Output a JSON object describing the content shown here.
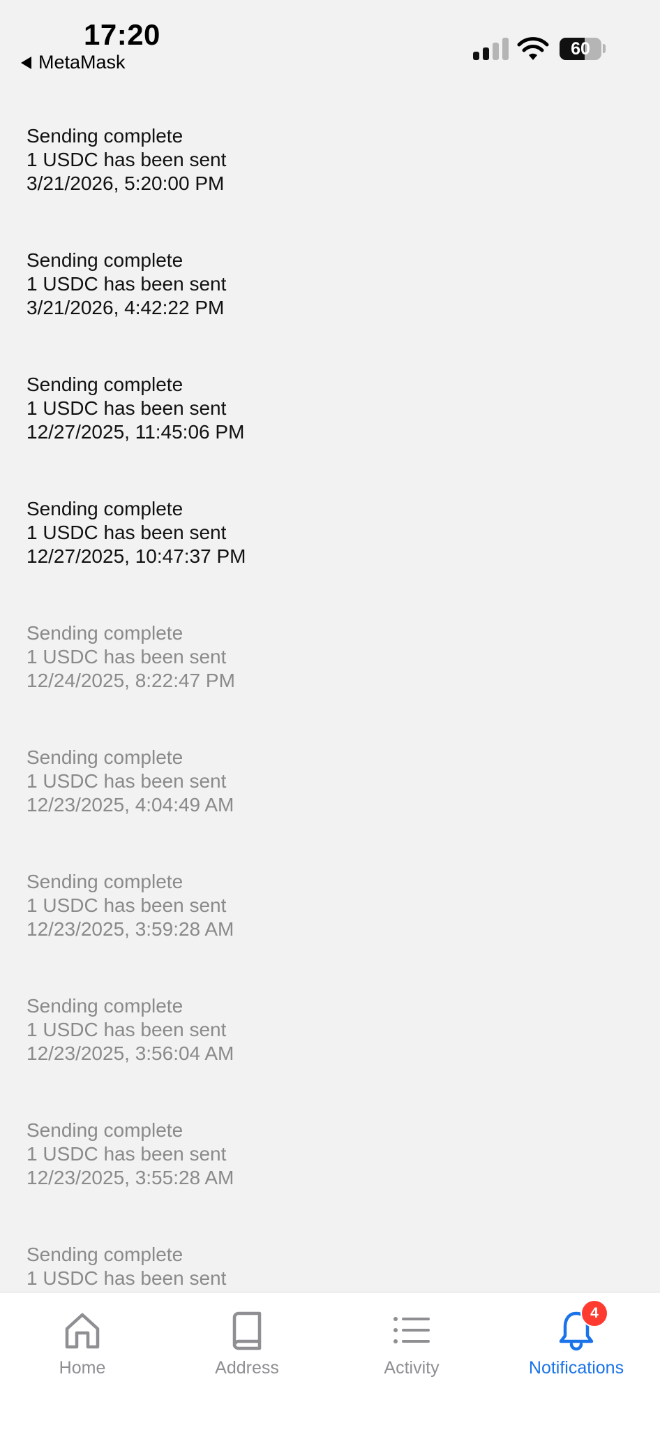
{
  "status_bar": {
    "time": "17:20",
    "back_app": "MetaMask",
    "battery_level": "60",
    "battery_fraction": 0.6,
    "signal_bars_filled": 2,
    "signal_bars_total": 4
  },
  "notifications": [
    {
      "title": "Sending complete",
      "message": "1 USDC has been sent",
      "timestamp": "3/21/2026, 5:20:00 PM",
      "read": false
    },
    {
      "title": "Sending complete",
      "message": "1 USDC has been sent",
      "timestamp": "3/21/2026, 4:42:22 PM",
      "read": false
    },
    {
      "title": "Sending complete",
      "message": "1 USDC has been sent",
      "timestamp": "12/27/2025, 11:45:06 PM",
      "read": false
    },
    {
      "title": "Sending complete",
      "message": "1 USDC has been sent",
      "timestamp": "12/27/2025, 10:47:37 PM",
      "read": false
    },
    {
      "title": "Sending complete",
      "message": "1 USDC has been sent",
      "timestamp": "12/24/2025, 8:22:47 PM",
      "read": true
    },
    {
      "title": "Sending complete",
      "message": "1 USDC has been sent",
      "timestamp": "12/23/2025, 4:04:49 AM",
      "read": true
    },
    {
      "title": "Sending complete",
      "message": "1 USDC has been sent",
      "timestamp": "12/23/2025, 3:59:28 AM",
      "read": true
    },
    {
      "title": "Sending complete",
      "message": "1 USDC has been sent",
      "timestamp": "12/23/2025, 3:56:04 AM",
      "read": true
    },
    {
      "title": "Sending complete",
      "message": "1 USDC has been sent",
      "timestamp": "12/23/2025, 3:55:28 AM",
      "read": true
    },
    {
      "title": "Sending complete",
      "message": "1 USDC has been sent",
      "timestamp": "",
      "read": true
    }
  ],
  "tab_bar": {
    "tabs": [
      {
        "label": "Home",
        "icon": "home-icon",
        "active": false
      },
      {
        "label": "Address",
        "icon": "book-icon",
        "active": false
      },
      {
        "label": "Activity",
        "icon": "list-icon",
        "active": false
      },
      {
        "label": "Notifications",
        "icon": "bell-icon",
        "active": true,
        "badge": "4"
      }
    ]
  },
  "colors": {
    "accent": "#1a73e8",
    "badge": "#ff3b30",
    "background": "#f2f2f2",
    "unread_text": "#111111",
    "read_text": "#8a8a8a"
  }
}
